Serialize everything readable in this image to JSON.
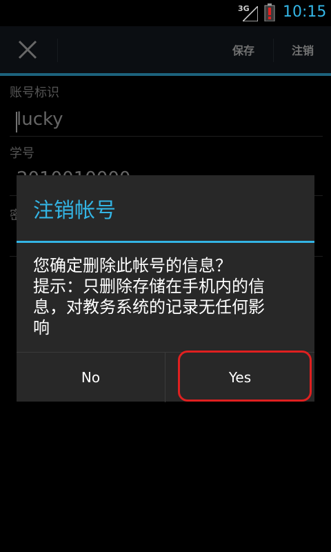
{
  "status_bar": {
    "network": "3G",
    "time": "10:15",
    "time_color": "#33b5e5",
    "battery_color": "#e02020"
  },
  "action_bar": {
    "close_icon": "close-icon",
    "save_label": "保存",
    "logout_label": "注销",
    "accent": "#33b5e5"
  },
  "form": {
    "account_label": "账号标识",
    "account_value": "lucky",
    "student_id_label": "学号",
    "student_id_value": "2010010000",
    "password_label": "密码"
  },
  "dialog": {
    "title": "注销帐号",
    "message_lines": [
      "您确定删除此帐号的信息？",
      "提示：只删除存储在手机内的信",
      "息，对教务系统的记录无任何影",
      "响"
    ],
    "no_label": "No",
    "yes_label": "Yes",
    "highlight_color": "#e02020"
  }
}
